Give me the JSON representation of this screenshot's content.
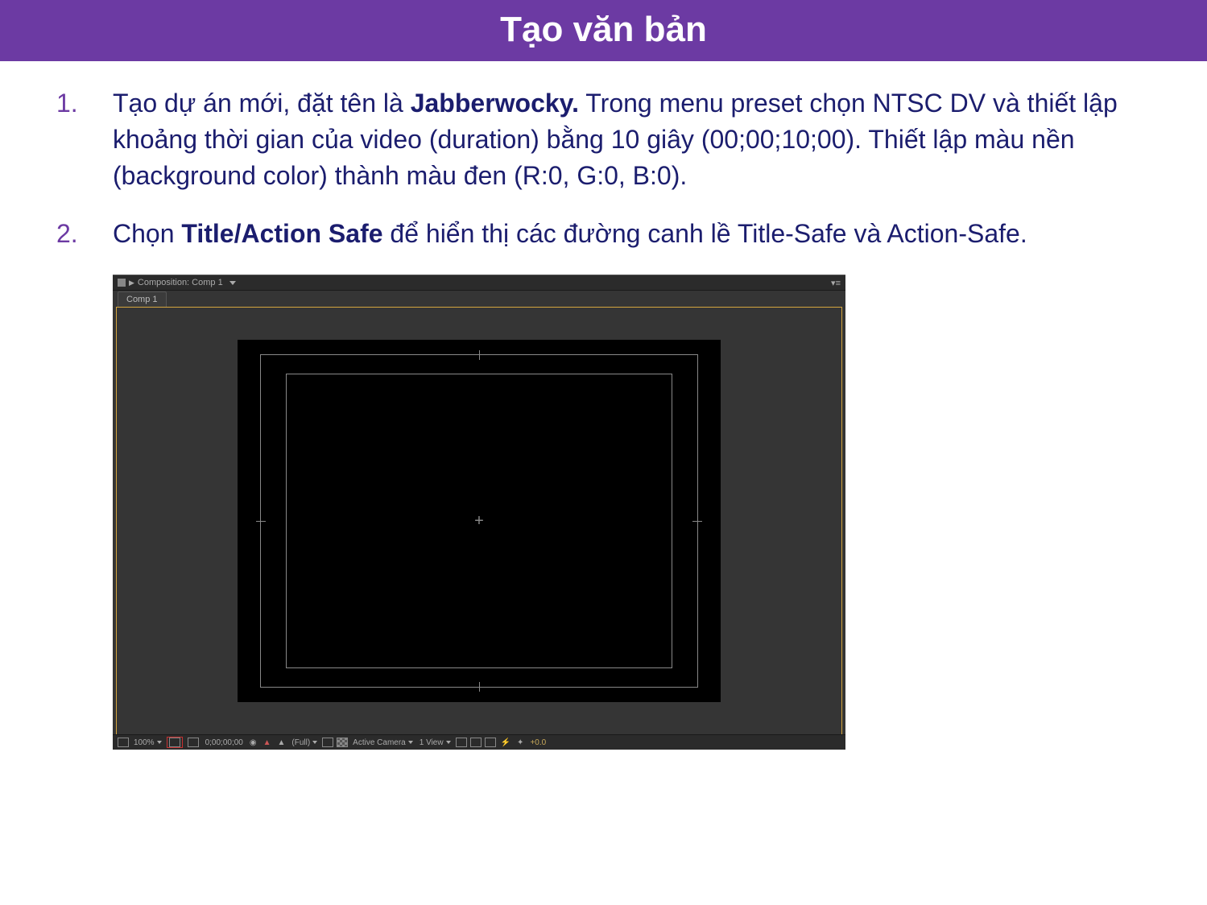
{
  "title": "Tạo văn bản",
  "steps": {
    "one": {
      "pre": "Tạo dự án mới, đặt tên là ",
      "bold": "Jabberwocky.",
      "post": " Trong menu preset chọn NTSC DV và thiết lập khoảng thời gian của video (duration) bằng 10 giây (00;00;10;00). Thiết lập màu nền (background color) thành màu đen (R:0, G:0, B:0)."
    },
    "two": {
      "pre": "Chọn ",
      "bold": "Title/Action Safe",
      "post": " để hiển thị các đường canh lề Title-Safe và Action-Safe."
    }
  },
  "panel": {
    "header_label": "Composition: Comp 1",
    "tab": "Comp 1",
    "bottom": {
      "zoom": "100%",
      "time": "0;00;00;00",
      "res": "(Full)",
      "camera": "Active Camera",
      "view": "1 View",
      "exposure": "+0.0"
    }
  }
}
